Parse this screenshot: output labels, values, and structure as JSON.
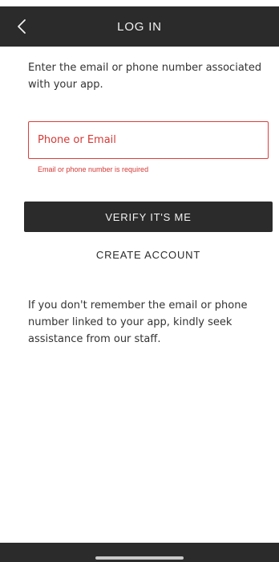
{
  "header": {
    "title": "LOG IN",
    "back_icon": "chevron-left-icon"
  },
  "intro_text": "Enter the email or phone number associated with your app.",
  "login_field": {
    "value": "",
    "placeholder": "Phone or Email",
    "error": "Email or phone number is required"
  },
  "verify_button_label": "VERIFY IT'S ME",
  "create_account_label": "CREATE ACCOUNT",
  "help_text": "If you don't remember the email or phone number linked to your app, kindly seek assistance from our staff.",
  "colors": {
    "dark": "#2b2b2b",
    "error": "#d33a36",
    "text": "#333333"
  }
}
